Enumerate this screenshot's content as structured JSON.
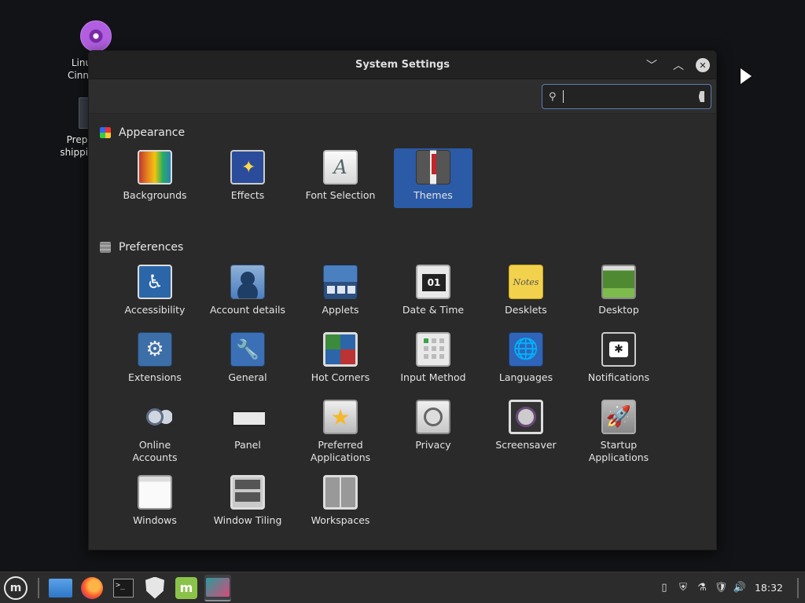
{
  "desktop": {
    "icons": [
      {
        "label_line1": "Linux",
        "label_line2": "Cinnan"
      },
      {
        "label_line1": "Prep",
        "label_line2": "shippin"
      }
    ]
  },
  "window": {
    "title": "System Settings",
    "search": {
      "value": "",
      "placeholder": ""
    }
  },
  "sections": {
    "appearance": {
      "title": "Appearance",
      "items": [
        "Backgrounds",
        "Effects",
        "Font Selection",
        "Themes"
      ],
      "selected": "Themes"
    },
    "preferences": {
      "title": "Preferences",
      "items": [
        "Accessibility",
        "Account details",
        "Applets",
        "Date & Time",
        "Desklets",
        "Desktop",
        "Extensions",
        "General",
        "Hot Corners",
        "Input Method",
        "Languages",
        "Notifications",
        "Online Accounts",
        "Panel",
        "Preferred Applications",
        "Privacy",
        "Screensaver",
        "Startup Applications",
        "Windows",
        "Window Tiling",
        "Workspaces"
      ]
    }
  },
  "icons": {
    "desklets_text": "Notes",
    "date_day": "01"
  },
  "taskbar": {
    "clock": "18:32",
    "accent": "#2b5aa6"
  }
}
